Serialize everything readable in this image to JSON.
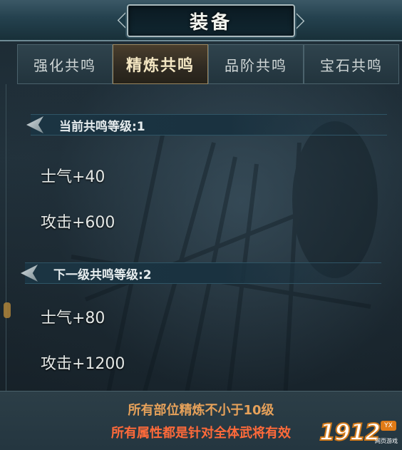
{
  "window": {
    "title": "装备"
  },
  "tabs": [
    {
      "label": "强化共鸣",
      "active": false
    },
    {
      "label": "精炼共鸣",
      "active": true
    },
    {
      "label": "品阶共鸣",
      "active": false
    },
    {
      "label": "宝石共鸣",
      "active": false
    }
  ],
  "current_level": {
    "header": "当前共鸣等级:1",
    "stats": [
      "士气+40",
      "攻击+600"
    ]
  },
  "next_level": {
    "header": "下一级共鸣等级:2",
    "stats": [
      "士气+80",
      "攻击+1200"
    ]
  },
  "footer": {
    "requirement": "所有部位精炼不小于10级",
    "effect_note": "所有属性都是针对全体武将有效"
  },
  "watermark": {
    "number": "1912",
    "badge": "YX",
    "caption": "网页游戏"
  },
  "colors": {
    "active_tab_text": "#f3e6c2",
    "requirement_text": "#e6a15a",
    "effect_text": "#ff6a3a"
  },
  "icons": [
    "section-arrow-icon",
    "title-ornament-icon"
  ]
}
